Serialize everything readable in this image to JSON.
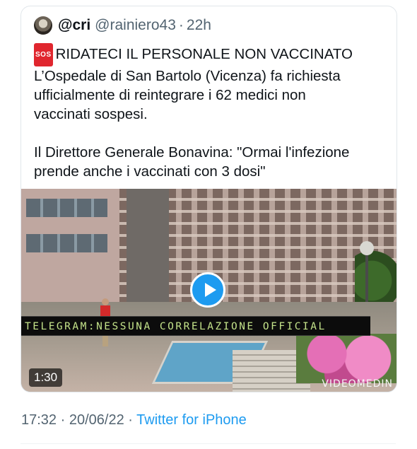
{
  "tweet": {
    "display_name": "@cri",
    "handle": "@rainiero43",
    "separator": "·",
    "relative_time": "22h",
    "sos_badge": "SOS",
    "headline": "RIDATECI IL PERSONALE NON VACCINATO",
    "line2": "L’Ospedale di San Bartolo (Vicenza) fa richiesta",
    "line3": "ufficialmente di reintegrare i 62 medici non",
    "line4": "vaccinati sospesi.",
    "line5": "Il Direttore Generale Bonavina: \"Ormai l'infezione",
    "line6": "prende anche i vaccinati con 3 dosi\""
  },
  "video": {
    "banner_text": "TELEGRAM:NESSUNA CORRELAZIONE OFFICIAL",
    "duration": "1:30",
    "watermark": "VIDEOMEDIN",
    "play_icon": "play-icon",
    "accent_color": "#1d9bf0"
  },
  "footer": {
    "time": "17:32",
    "sep1": "·",
    "date": "20/06/22",
    "sep2": "·",
    "source": "Twitter for iPhone"
  }
}
